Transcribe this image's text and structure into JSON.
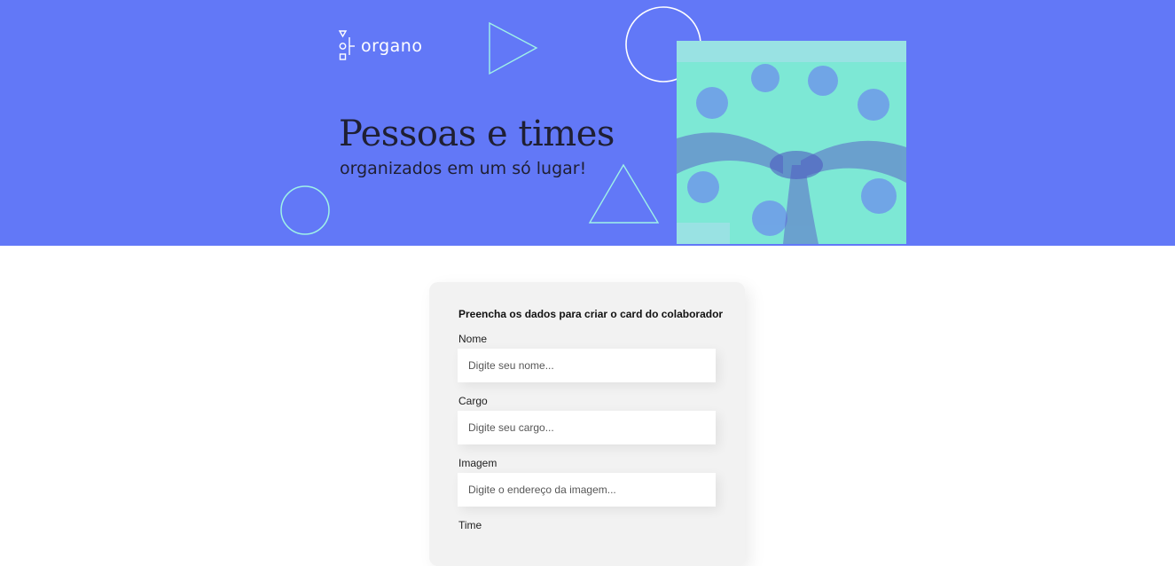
{
  "header": {
    "logo_text": "organo",
    "headline": "Pessoas e times",
    "subheadline": "organizados em um só lugar!",
    "photo_alt": "Pessoas unindo as mãos em círculo"
  },
  "colors": {
    "banner_background": "#6278F7",
    "decoration_stroke": "#9FF2E8",
    "photo_tint": "#7DE8D5"
  },
  "form": {
    "title": "Preencha os dados para criar o card do colaborador",
    "fields": [
      {
        "label": "Nome",
        "placeholder": "Digite seu nome..."
      },
      {
        "label": "Cargo",
        "placeholder": "Digite seu cargo..."
      },
      {
        "label": "Imagem",
        "placeholder": "Digite o endereço da imagem..."
      },
      {
        "label": "Time"
      }
    ]
  }
}
